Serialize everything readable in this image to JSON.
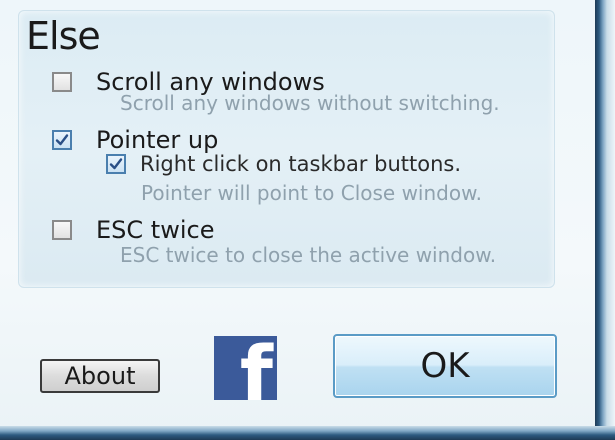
{
  "group": {
    "title": "Else",
    "options": [
      {
        "label": "Scroll any windows",
        "description": "Scroll any windows without switching.",
        "checked": false
      },
      {
        "label": "Pointer up",
        "checked": true,
        "sub_option": {
          "label": "Right click on taskbar buttons.",
          "description": "Pointer will point to Close window.",
          "checked": true
        }
      },
      {
        "label": "ESC twice",
        "description": "ESC twice to close the active window.",
        "checked": false
      }
    ]
  },
  "buttons": {
    "about_label": "About",
    "ok_label": "OK",
    "facebook_glyph": "f"
  },
  "colors": {
    "facebook_blue": "#3b5a9a",
    "description_text": "#8fa1ad",
    "ok_button_border": "#5a9bc6"
  },
  "icons": {
    "checkmark": "check-icon",
    "facebook": "facebook-icon"
  }
}
